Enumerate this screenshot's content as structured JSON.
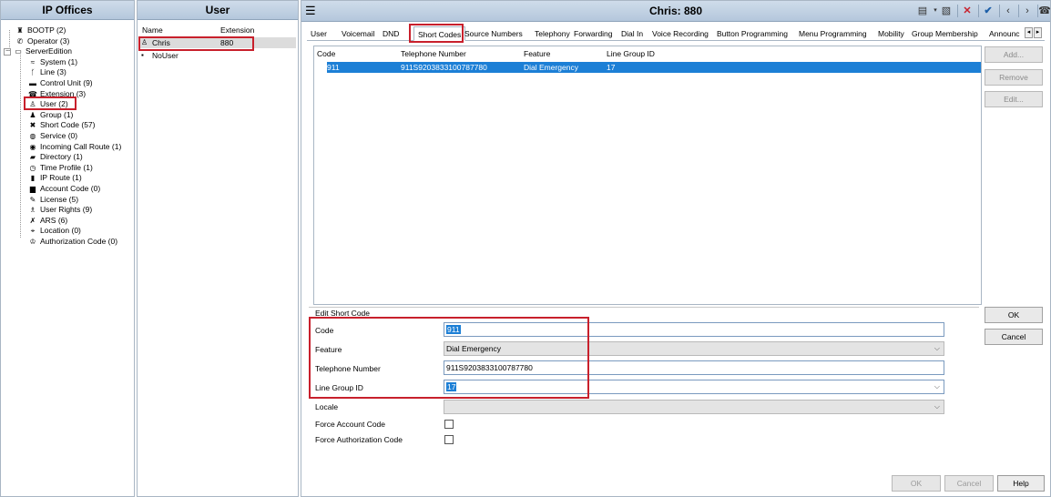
{
  "left_panel": {
    "title": "IP Offices",
    "items": [
      {
        "label": "BOOTP (2)",
        "icon": "bootp-icon",
        "glyph": "♜"
      },
      {
        "label": "Operator (3)",
        "icon": "operator-icon",
        "glyph": "✆"
      },
      {
        "label": "ServerEdition",
        "icon": "server-icon",
        "glyph": "▭"
      },
      {
        "label": "System (1)",
        "icon": "system-icon",
        "glyph": "≈"
      },
      {
        "label": "Line (3)",
        "icon": "line-icon",
        "glyph": "ᚴ"
      },
      {
        "label": "Control Unit (9)",
        "icon": "control-unit-icon",
        "glyph": "▬"
      },
      {
        "label": "Extension (3)",
        "icon": "extension-icon",
        "glyph": "☎"
      },
      {
        "label": "User (2)",
        "icon": "user-icon",
        "glyph": "♙"
      },
      {
        "label": "Group (1)",
        "icon": "group-icon",
        "glyph": "♟"
      },
      {
        "label": "Short Code (57)",
        "icon": "short-code-icon",
        "glyph": "✖"
      },
      {
        "label": "Service (0)",
        "icon": "service-icon",
        "glyph": "◍"
      },
      {
        "label": "Incoming Call Route (1)",
        "icon": "incoming-call-route-icon",
        "glyph": "◉"
      },
      {
        "label": "Directory (1)",
        "icon": "directory-icon",
        "glyph": "▰"
      },
      {
        "label": "Time Profile (1)",
        "icon": "time-profile-icon",
        "glyph": "◷"
      },
      {
        "label": "IP Route (1)",
        "icon": "ip-route-icon",
        "glyph": "▮"
      },
      {
        "label": "Account Code (0)",
        "icon": "account-code-icon",
        "glyph": "▆"
      },
      {
        "label": "License (5)",
        "icon": "license-icon",
        "glyph": "✎"
      },
      {
        "label": "User Rights (9)",
        "icon": "user-rights-icon",
        "glyph": "♗"
      },
      {
        "label": "ARS (6)",
        "icon": "ars-icon",
        "glyph": "✗"
      },
      {
        "label": "Location (0)",
        "icon": "location-icon",
        "glyph": "⌖"
      },
      {
        "label": "Authorization Code (0)",
        "icon": "authorization-code-icon",
        "glyph": "♔"
      }
    ]
  },
  "mid_panel": {
    "title": "User",
    "columns": [
      "Name",
      "Extension"
    ],
    "rows": [
      {
        "name": "Chris",
        "extension": "880"
      },
      {
        "name": "NoUser",
        "extension": ""
      }
    ]
  },
  "main": {
    "title": "Chris: 880",
    "tabs": [
      "User",
      "Voicemail",
      "DND",
      "Short Codes",
      "Source Numbers",
      "Telephony",
      "Forwarding",
      "Dial In",
      "Voice Recording",
      "Button Programming",
      "Menu Programming",
      "Mobility",
      "Group Membership",
      "Announc"
    ],
    "active_tab": "Short Codes",
    "grid": {
      "columns": [
        "Code",
        "Telephone Number",
        "Feature",
        "Line Group ID"
      ],
      "rows": [
        {
          "code": "911",
          "telephone_number": "911S9203833100787780",
          "feature": "Dial Emergency",
          "line_group_id": "17"
        }
      ]
    },
    "side_buttons": {
      "add": "Add...",
      "remove": "Remove",
      "edit": "Edit..."
    },
    "edit_form": {
      "title": "Edit Short Code",
      "code_label": "Code",
      "code_value": "911",
      "feature_label": "Feature",
      "feature_value": "Dial Emergency",
      "telephone_label": "Telephone Number",
      "telephone_value": "911S9203833100787780",
      "line_group_label": "Line Group ID",
      "line_group_value": "17",
      "locale_label": "Locale",
      "locale_value": "",
      "force_account_label": "Force Account Code",
      "force_auth_label": "Force Authorization Code"
    },
    "form_buttons": {
      "ok": "OK",
      "cancel": "Cancel"
    },
    "bottom_buttons": {
      "ok": "OK",
      "cancel": "Cancel",
      "help": "Help"
    }
  }
}
